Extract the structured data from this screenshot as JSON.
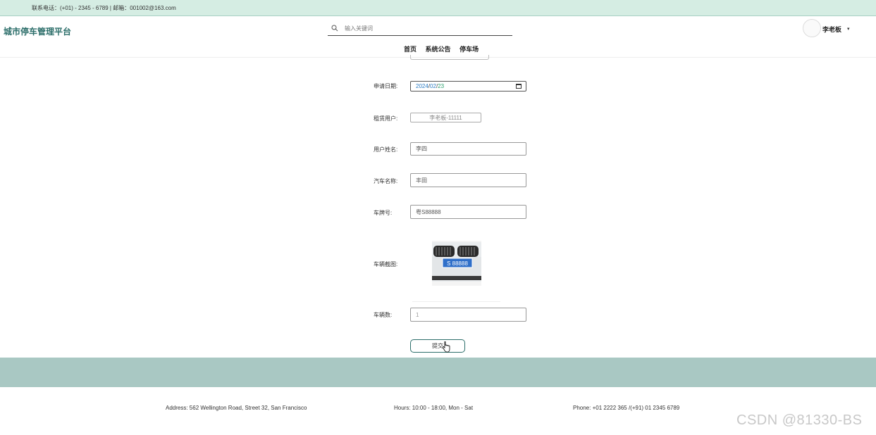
{
  "topbar": {
    "contact": "联系电话：(+01) - 2345 - 6789 | 邮箱：001002@163.com"
  },
  "header": {
    "logo": "城市停车管理平台",
    "search_placeholder": "输入关键词",
    "user_name": "李老板",
    "caret": "▾",
    "nav": [
      "首页",
      "系统公告",
      "停车场"
    ]
  },
  "form": {
    "apply_date_label": "申请日期:",
    "apply_date": {
      "year": "2024",
      "month": "02",
      "day": "23",
      "sep": "/"
    },
    "rental_user_label": "租赁用户:",
    "rental_user_value": "李老板-11111",
    "user_name_label": "用户姓名:",
    "user_name_value": "李四",
    "car_name_label": "汽车名称:",
    "car_name_value": "丰田",
    "plate_label": "车牌号:",
    "plate_value": "粤S88888",
    "car_image_label": "车辆截图:",
    "car_image_plate_text": "S 88888",
    "car_count_label": "车辆数:",
    "car_count_value": "1",
    "submit_label": "提交"
  },
  "footer": {
    "address": "Address: 562 Wellington Road, Street 32, San Francisco",
    "hours": "Hours: 10:00 - 18:00, Mon - Sat",
    "phone": "Phone: +01 2222 365 /(+91) 01 2345 6789"
  },
  "watermark": "CSDN @81330-BS",
  "colors": {
    "topbar_bg": "#d5ede3",
    "band_bg": "#a9c8c3",
    "brand": "#2c6e6a"
  }
}
